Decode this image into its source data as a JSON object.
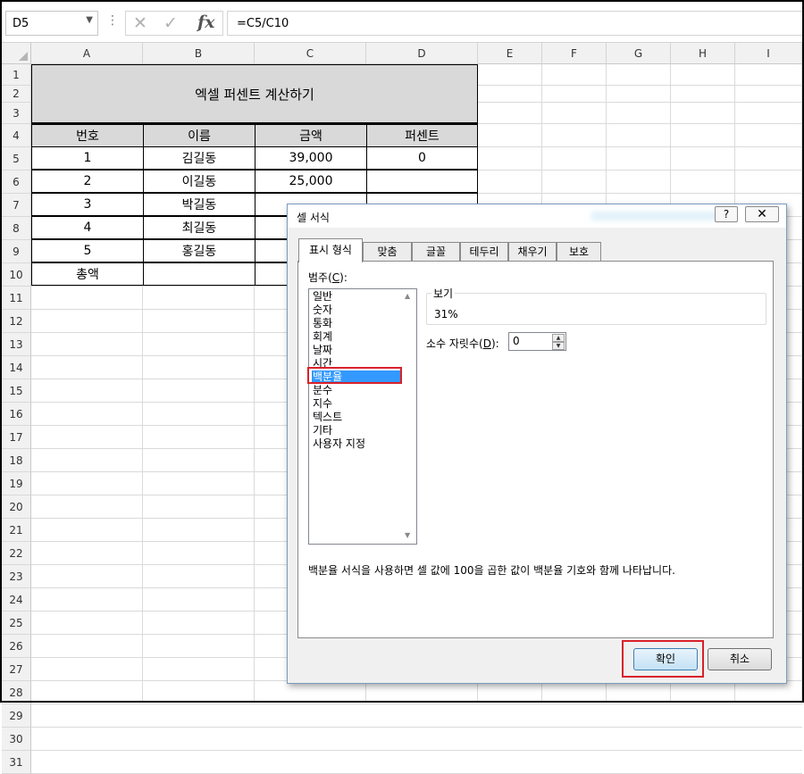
{
  "formula_bar": {
    "name_box": "D5",
    "formula": "=C5/C10"
  },
  "columns": [
    "A",
    "B",
    "C",
    "D",
    "E",
    "F",
    "G",
    "H",
    "I"
  ],
  "rows": [
    "1",
    "2",
    "3",
    "4",
    "5",
    "6",
    "7",
    "8",
    "9",
    "10",
    "11",
    "12",
    "13",
    "14",
    "15",
    "16",
    "17",
    "18",
    "19",
    "20",
    "21",
    "22",
    "23",
    "24",
    "25",
    "26",
    "27",
    "28",
    "29",
    "30",
    "31"
  ],
  "sheet": {
    "title": "엑셀 퍼센트 계산하기",
    "headers": [
      "번호",
      "이름",
      "금액",
      "퍼센트"
    ],
    "rows": [
      {
        "no": "1",
        "name": "김길동",
        "amount": "39,000",
        "percent": "0"
      },
      {
        "no": "2",
        "name": "이길동",
        "amount": "25,000",
        "percent": ""
      },
      {
        "no": "3",
        "name": "박길동",
        "amount": "",
        "percent": ""
      },
      {
        "no": "4",
        "name": "최길동",
        "amount": "",
        "percent": ""
      },
      {
        "no": "5",
        "name": "홍길동",
        "amount": "",
        "percent": ""
      }
    ],
    "total_label": "총액"
  },
  "dialog": {
    "title": "셀 서식",
    "help": "?",
    "close": "✕",
    "tabs": [
      "표시 형식",
      "맞춤",
      "글꼴",
      "테두리",
      "채우기",
      "보호"
    ],
    "active_tab": "표시 형식",
    "category_label": "범주(",
    "category_key": "C",
    "category_label_end": "):",
    "categories": [
      "일반",
      "숫자",
      "통화",
      "회계",
      "날짜",
      "시간",
      "백분율",
      "분수",
      "지수",
      "텍스트",
      "기타",
      "사용자 지정"
    ],
    "selected_category": "백분율",
    "preview_label": "보기",
    "preview_value": "31%",
    "decimal_label": "소수 자릿수(",
    "decimal_key": "D",
    "decimal_label_end": "):",
    "decimal_value": "0",
    "description": "백분율 서식을 사용하면 셀 값에 100을 곱한 값이 백분율 기호와 함께 나타납니다.",
    "ok": "확인",
    "cancel": "취소"
  },
  "colors": {
    "header_fill": "#d9d9d9",
    "selection": "#3399ff",
    "highlight": "#d9212a"
  }
}
